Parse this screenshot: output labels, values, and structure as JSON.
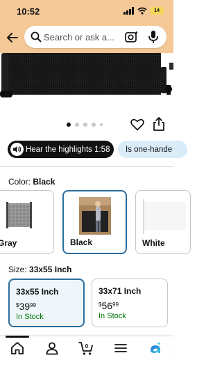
{
  "status_bar": {
    "time": "10:52",
    "battery": "14"
  },
  "search": {
    "placeholder": "Search or ask a..."
  },
  "carousel": {
    "total_dots": 5,
    "active_index": 0
  },
  "highlights": {
    "label": "Hear the highlights 1:58"
  },
  "chip": {
    "label": "Is one-hande"
  },
  "color": {
    "label": "Color:",
    "selected": "Black",
    "options": [
      {
        "name": "Gray"
      },
      {
        "name": "Black"
      },
      {
        "name": "White"
      }
    ]
  },
  "size": {
    "label": "Size:",
    "selected": "33x55 Inch",
    "options": [
      {
        "name": "33x55 Inch",
        "currency": "$",
        "price_whole": "39",
        "price_cents": "99",
        "stock": "In Stock"
      },
      {
        "name": "33x71 Inch",
        "currency": "$",
        "price_whole": "56",
        "price_cents": "99",
        "stock": "In Stock"
      }
    ]
  },
  "colors": {
    "header_bg": "#f5c997",
    "accent_blue": "#2b6d9d",
    "in_stock_green": "#007600",
    "chip_bg": "#d9ecf8"
  },
  "icons": {
    "nav": [
      "home-icon",
      "account-icon",
      "cart-icon",
      "menu-icon",
      "ai-assistant-icon"
    ],
    "cart_count": "0"
  }
}
